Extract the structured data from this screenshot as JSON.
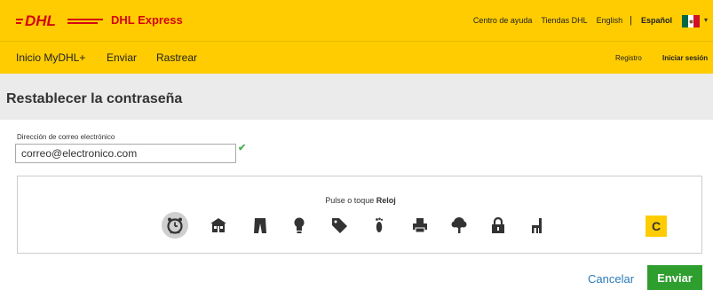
{
  "header": {
    "logo_text": "DHL",
    "brand": "DHL Express",
    "links": [
      "Centro de ayuda",
      "Tiendas DHL",
      "English",
      "Español"
    ],
    "language_separator": "|",
    "flag": "mexico-flag",
    "flag_colors": [
      "#006847",
      "#ffffff",
      "#ce1126"
    ],
    "caret": "▾"
  },
  "nav": {
    "items": [
      "Inicio MyDHL+",
      "Enviar",
      "Rastrear"
    ],
    "register": "Registro",
    "login": "Iniciar sesión"
  },
  "page": {
    "title": "Restablecer la contraseña"
  },
  "form": {
    "email_label": "Dirección de correo electrónico",
    "email_value": "correo@electronico.com",
    "check": "✔"
  },
  "captcha": {
    "prompt_prefix": "Pulse o toque",
    "prompt_target": "Reloj",
    "icons": [
      "clock-icon",
      "house-icon",
      "pants-icon",
      "lightbulb-icon",
      "tag-icon",
      "footprint-icon",
      "printer-icon",
      "tree-icon",
      "lock-icon",
      "chair-icon"
    ],
    "selected": "clock-icon",
    "refresh_symbol": "C"
  },
  "actions": {
    "cancel": "Cancelar",
    "submit": "Enviar"
  },
  "colors": {
    "dhl_yellow": "#fecc00",
    "dhl_red": "#d40511",
    "submit_green": "#2e9e2e",
    "link_blue": "#2b7bb9"
  }
}
